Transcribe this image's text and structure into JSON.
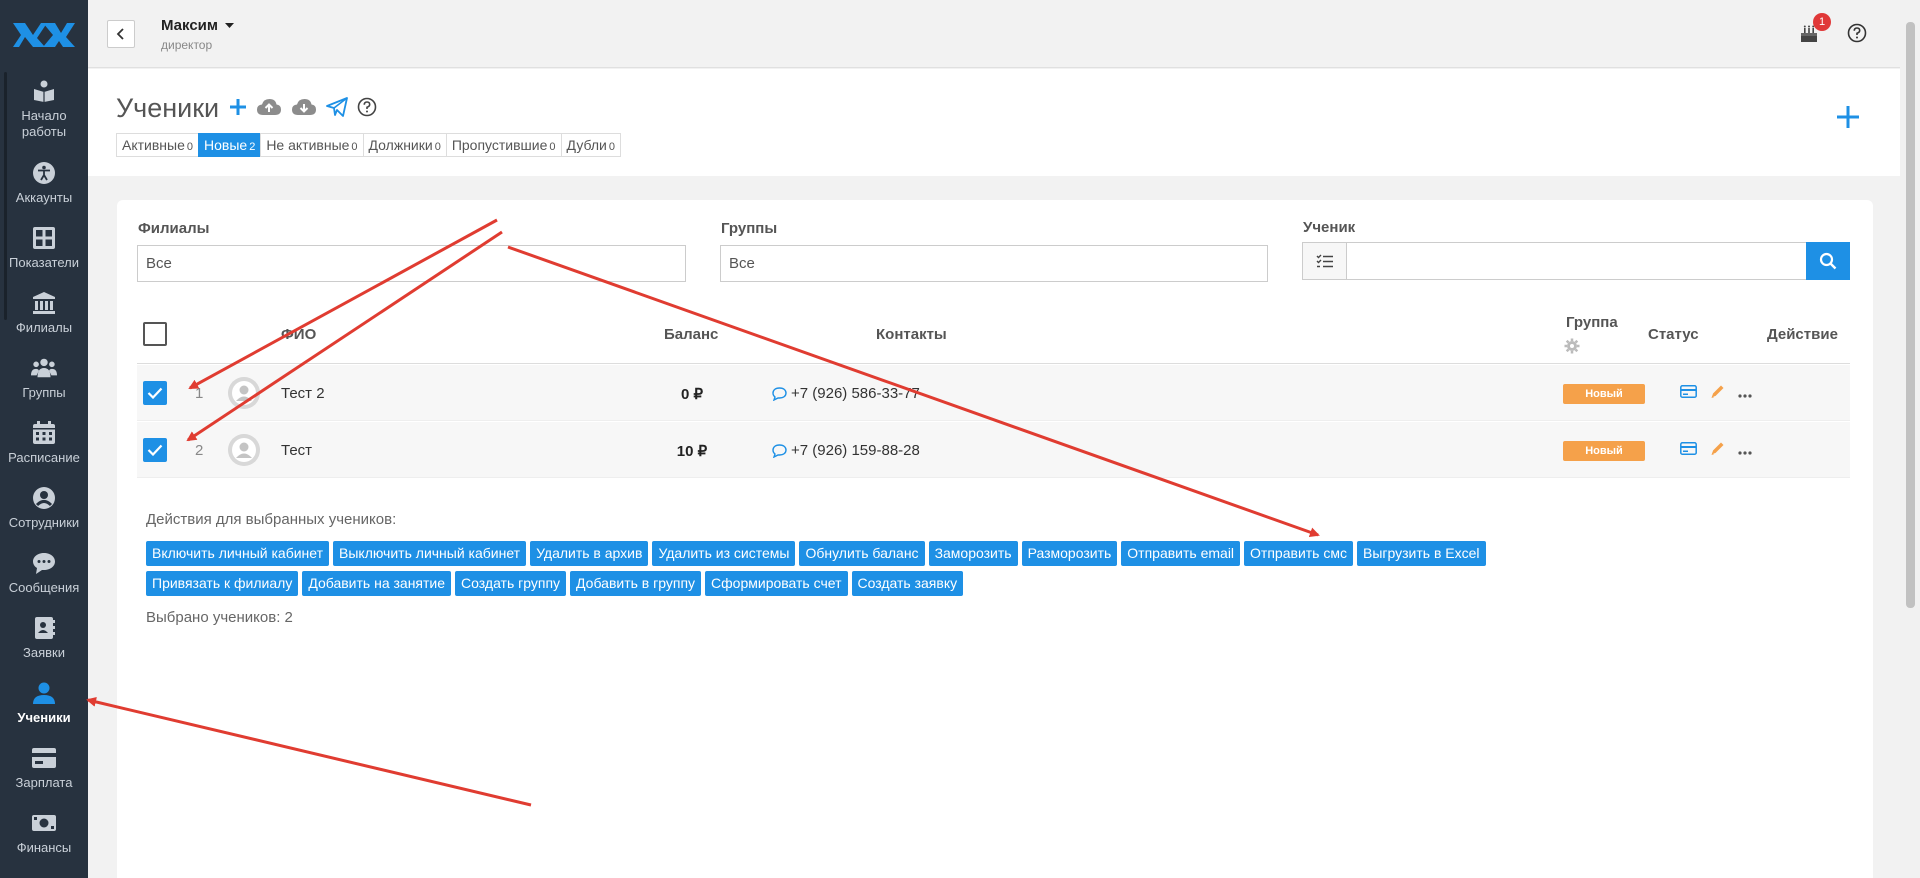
{
  "sidebar": {
    "items": [
      {
        "label": "Начало работы",
        "icon": "book-icon"
      },
      {
        "label": "Аккаунты",
        "icon": "accessibility-icon"
      },
      {
        "label": "Показатели",
        "icon": "grid-icon"
      },
      {
        "label": "Филиалы",
        "icon": "bank-icon"
      },
      {
        "label": "Группы",
        "icon": "users-icon"
      },
      {
        "label": "Расписание",
        "icon": "calendar-icon"
      },
      {
        "label": "Сотрудники",
        "icon": "user-circle-icon"
      },
      {
        "label": "Сообщения",
        "icon": "chat-icon"
      },
      {
        "label": "Заявки",
        "icon": "contact-book-icon"
      },
      {
        "label": "Ученики",
        "icon": "person-icon",
        "active": true
      },
      {
        "label": "Зарплата",
        "icon": "credit-card-icon"
      },
      {
        "label": "Финансы",
        "icon": "money-icon"
      }
    ]
  },
  "topbar": {
    "user_name": "Максим",
    "user_role": "директор",
    "notification_count": "1"
  },
  "header": {
    "title": "Ученики",
    "tabs": [
      {
        "label": "Активные",
        "count": "0"
      },
      {
        "label": "Новые",
        "count": "2",
        "active": true
      },
      {
        "label": "Не активные",
        "count": "0"
      },
      {
        "label": "Должники",
        "count": "0"
      },
      {
        "label": "Пропустившие",
        "count": "0"
      },
      {
        "label": "Дубли",
        "count": "0"
      }
    ]
  },
  "filters": {
    "branches_label": "Филиалы",
    "branches_value": "Все",
    "groups_label": "Группы",
    "groups_value": "Все",
    "student_label": "Ученик"
  },
  "table": {
    "headers": {
      "fio": "ФИО",
      "balance": "Баланс",
      "contacts": "Контакты",
      "group": "Группа",
      "status": "Статус",
      "action": "Действие"
    },
    "rows": [
      {
        "num": "1",
        "name": "Тест 2",
        "balance": "0 ₽",
        "phone": "+7 (926) 586-33-77",
        "status": "Новый"
      },
      {
        "num": "2",
        "name": "Тест",
        "balance": "10 ₽",
        "phone": "+7 (926) 159-88-28",
        "status": "Новый"
      }
    ]
  },
  "bulk": {
    "title": "Действия для выбранных учеников:",
    "row1": [
      "Включить личный кабинет",
      "Выключить личный кабинет",
      "Удалить в архив",
      "Удалить из системы",
      "Обнулить баланс",
      "Заморозить",
      "Разморозить",
      "Отправить email",
      "Отправить смс",
      "Выгрузить в Excel"
    ],
    "row2": [
      "Привязать к филиалу",
      "Добавить на занятие",
      "Создать группу",
      "Добавить в группу",
      "Сформировать счет",
      "Создать заявку"
    ],
    "selected_count": "Выбрано учеников: 2"
  },
  "colors": {
    "accent": "#1e90e5",
    "sidebar": "#27323f",
    "status_new": "#f5a14a",
    "arrow": "#e03c31"
  }
}
